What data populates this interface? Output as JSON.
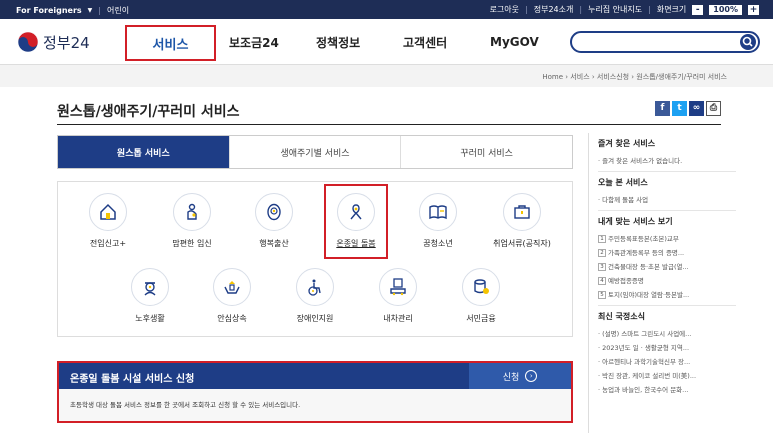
{
  "util": {
    "foreigners": "For Foreigners",
    "kids": "어린이",
    "logout": "로그아웃",
    "about": "정부24소개",
    "sitemap": "누리집 안내지도",
    "screen_size": "화면크기",
    "minus": "-",
    "zoom": "100%",
    "plus": "+"
  },
  "gnb": {
    "logo": "정부24",
    "menu": [
      "서비스",
      "보조금24",
      "정책정보",
      "고객센터",
      "MyGOV"
    ],
    "search_placeholder": ""
  },
  "breadcrumb": "Home › 서비스 › 서비스신청 › 원스톱/생애주기/꾸러미 서비스",
  "page_title": "원스톱/생애주기/꾸러미 서비스",
  "tabs": [
    "원스톱 서비스",
    "생애주기별 서비스",
    "꾸러미 서비스"
  ],
  "services_row1": [
    "전입신고+",
    "맘편한 임신",
    "행복출산",
    "온종일 돌봄",
    "꿈청소년",
    "취업서류(공직자)"
  ],
  "services_row2": [
    "노후생활",
    "안심상속",
    "장애인지원",
    "내차관리",
    "서민금융"
  ],
  "apply": {
    "title": "온종일 돌봄 시설 서비스 신청",
    "button": "신청",
    "description": "초등학생 대상 돌봄 서비스 정보를 한 곳에서 조회하고 신청 할 수 있는 서비스입니다."
  },
  "sidebar": {
    "favorites_title": "즐겨 찾은 서비스",
    "favorites_empty": "· 즐겨 찾은 서비스가 없습니다.",
    "today_title": "오늘 본 서비스",
    "today_items": [
      "· 다함께 돌봄 사업"
    ],
    "fit_title": "내게 맞는 서비스 보기",
    "fit_items": [
      "주민등록표등본(초본)교부",
      "가족관계등록부 등의 증명...",
      "건축물대장 등·초본 발급(열...",
      "예방접종증명",
      "토지(임야)대장 열람·등본발..."
    ],
    "news_title": "최신 국정소식",
    "news_items": [
      "· (설명) 스마트 그린도시 사업에...",
      "· 2023년도 일 · 생활균형 지역...",
      "· 아르헨티나 과학기술혁신부 장...",
      "· 박진 장관, 케이코 설리번 미(美)...",
      "· 농업과 바늘인, 한국수어 문화..."
    ]
  },
  "colors": {
    "navy": "#1e2d56",
    "brand_blue": "#1e3d86",
    "highlight_red": "#d21f27"
  }
}
